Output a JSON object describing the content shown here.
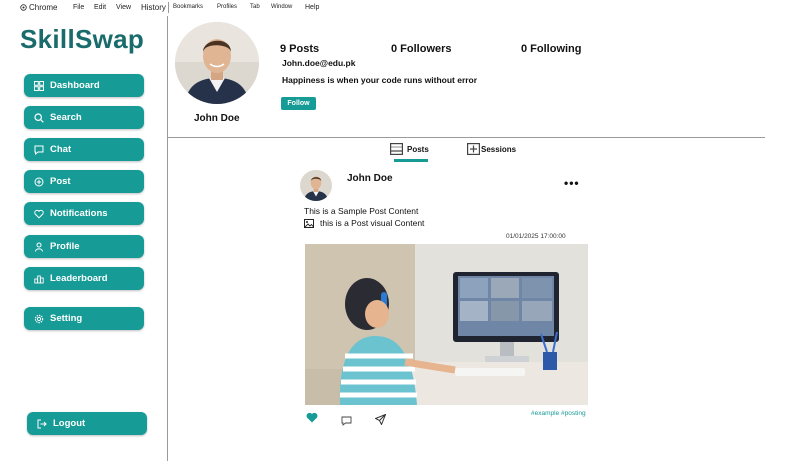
{
  "menubar": {
    "app": "Chrome",
    "items": [
      "File",
      "Edit",
      "View",
      "History",
      "Bookmarks",
      "Profiles",
      "Tab",
      "Window",
      "Help"
    ]
  },
  "sidebar": {
    "brand": "SkillSwap",
    "items": [
      {
        "label": "Dashboard",
        "icon": "grid-icon"
      },
      {
        "label": "Search",
        "icon": "search-icon"
      },
      {
        "label": "Chat",
        "icon": "chat-icon"
      },
      {
        "label": "Post",
        "icon": "plus-circle-icon"
      },
      {
        "label": "Notifications",
        "icon": "heart-icon"
      },
      {
        "label": "Profile",
        "icon": "user-icon"
      },
      {
        "label": "Leaderboard",
        "icon": "leaderboard-icon"
      },
      {
        "label": "Setting",
        "icon": "gear-icon"
      }
    ],
    "logout": "Logout"
  },
  "profile": {
    "name": "John Doe",
    "posts": "9 Posts",
    "followers": "0 Followers",
    "following": "0 Following",
    "email": "John.doe@edu.pk",
    "bio": "Happiness is when your code runs without error",
    "follow_label": "Follow"
  },
  "tabs": [
    {
      "label": "Posts",
      "active": true
    },
    {
      "label": "Sessions",
      "active": false
    }
  ],
  "post": {
    "author": "John Doe",
    "text": "This is a Sample Post Content",
    "visual_text": "this is a Post visual Content",
    "timestamp": "01/01/2025  17:00:00",
    "tags": "#example  #posting"
  },
  "colors": {
    "accent": "#179b96",
    "brand": "#1a6b6b"
  }
}
